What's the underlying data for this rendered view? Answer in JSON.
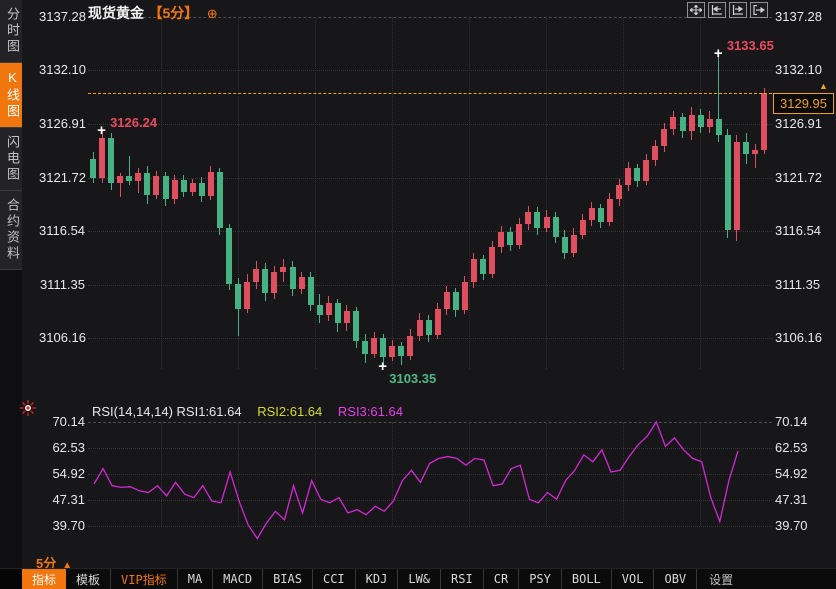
{
  "header": {
    "title": "现货黄金",
    "period_tag": "【5分】",
    "plus_icon": "⊕",
    "icons": [
      "pan-move-icon",
      "snap-left-icon",
      "snap-right-icon",
      "collapse-right-icon"
    ]
  },
  "sidebar": {
    "tabs": [
      {
        "label": "分时图",
        "active": false
      },
      {
        "label": "K线图",
        "active": true
      },
      {
        "label": "闪电图",
        "active": false
      },
      {
        "label": "合约资料",
        "active": false
      }
    ]
  },
  "colors": {
    "accent_orange": "#f2760e",
    "price_orange": "#f2a019",
    "up_red": "#e04f60",
    "down_green": "#46b182",
    "rsi_magenta": "#d428d4",
    "rsi_yellow": "#d8d832"
  },
  "chart_data": {
    "type": "candlestick",
    "symbol": "现货黄金",
    "interval": "5分",
    "y_axis_labels": [
      "3137.28",
      "3132.10",
      "3126.91",
      "3121.72",
      "3116.54",
      "3111.35",
      "3106.16"
    ],
    "y_axis_values": [
      3137.28,
      3132.1,
      3126.91,
      3121.72,
      3116.54,
      3111.35,
      3106.16
    ],
    "current_price": "3129.95",
    "current_price_value": 3129.95,
    "markers": [
      {
        "label": "3126.24",
        "price": 3126.24,
        "candle_index": 1,
        "type": "high",
        "color": "#ea4a5e"
      },
      {
        "label": "3133.65",
        "price": 3133.65,
        "candle_index": 69,
        "type": "high",
        "color": "#ea4a5e"
      },
      {
        "label": "3103.35",
        "price": 3103.35,
        "candle_index": 32,
        "type": "low",
        "color": "#4db887"
      }
    ],
    "candles": [
      [
        3123.5,
        3124.2,
        3121.2,
        3121.7
      ],
      [
        3121.7,
        3126.24,
        3121.2,
        3125.6
      ],
      [
        3125.6,
        3126.0,
        3120.5,
        3121.2
      ],
      [
        3121.2,
        3122.2,
        3119.8,
        3121.9
      ],
      [
        3121.9,
        3123.8,
        3121.0,
        3121.4
      ],
      [
        3121.4,
        3122.6,
        3120.2,
        3122.2
      ],
      [
        3122.2,
        3122.8,
        3119.2,
        3120.0
      ],
      [
        3120.0,
        3122.4,
        3119.6,
        3121.9
      ],
      [
        3121.9,
        3122.3,
        3119.0,
        3119.6
      ],
      [
        3119.6,
        3122.0,
        3119.2,
        3121.5
      ],
      [
        3121.5,
        3122.0,
        3119.8,
        3120.3
      ],
      [
        3120.3,
        3121.6,
        3119.9,
        3121.2
      ],
      [
        3121.2,
        3121.8,
        3119.4,
        3119.9
      ],
      [
        3119.9,
        3122.8,
        3119.5,
        3122.3
      ],
      [
        3122.3,
        3122.6,
        3116.2,
        3116.8
      ],
      [
        3116.8,
        3117.2,
        3110.8,
        3111.4
      ],
      [
        3111.4,
        3112.0,
        3106.4,
        3109.0
      ],
      [
        3109.0,
        3112.4,
        3108.6,
        3111.6
      ],
      [
        3111.6,
        3113.6,
        3110.9,
        3112.9
      ],
      [
        3112.9,
        3113.4,
        3109.8,
        3110.5
      ],
      [
        3110.5,
        3113.2,
        3110.0,
        3112.6
      ],
      [
        3112.6,
        3113.8,
        3111.6,
        3113.1
      ],
      [
        3113.1,
        3113.6,
        3110.2,
        3110.9
      ],
      [
        3110.9,
        3112.6,
        3110.4,
        3112.1
      ],
      [
        3112.1,
        3112.6,
        3108.8,
        3109.4
      ],
      [
        3109.4,
        3110.4,
        3107.6,
        3108.4
      ],
      [
        3108.4,
        3110.2,
        3107.8,
        3109.6
      ],
      [
        3109.6,
        3110.0,
        3106.8,
        3107.6
      ],
      [
        3107.6,
        3109.4,
        3106.9,
        3108.8
      ],
      [
        3108.8,
        3109.2,
        3105.2,
        3105.9
      ],
      [
        3105.9,
        3106.6,
        3103.8,
        3104.6
      ],
      [
        3104.6,
        3106.8,
        3104.2,
        3106.2
      ],
      [
        3106.2,
        3106.6,
        3103.35,
        3104.3
      ],
      [
        3104.3,
        3106.0,
        3103.9,
        3105.4
      ],
      [
        3105.4,
        3105.8,
        3103.6,
        3104.4
      ],
      [
        3104.4,
        3107.0,
        3104.0,
        3106.4
      ],
      [
        3106.4,
        3108.6,
        3105.9,
        3107.9
      ],
      [
        3107.9,
        3108.4,
        3105.8,
        3106.5
      ],
      [
        3106.5,
        3109.6,
        3106.1,
        3109.0
      ],
      [
        3109.0,
        3111.2,
        3108.4,
        3110.6
      ],
      [
        3110.6,
        3111.0,
        3108.2,
        3108.9
      ],
      [
        3108.9,
        3112.2,
        3108.5,
        3111.6
      ],
      [
        3111.6,
        3114.4,
        3111.0,
        3113.8
      ],
      [
        3113.8,
        3114.2,
        3111.8,
        3112.4
      ],
      [
        3112.4,
        3115.6,
        3112.0,
        3115.0
      ],
      [
        3115.0,
        3117.0,
        3114.4,
        3116.4
      ],
      [
        3116.4,
        3116.9,
        3114.6,
        3115.2
      ],
      [
        3115.2,
        3117.8,
        3114.8,
        3117.2
      ],
      [
        3117.2,
        3119.0,
        3116.6,
        3118.4
      ],
      [
        3118.4,
        3118.9,
        3116.2,
        3116.8
      ],
      [
        3116.8,
        3118.6,
        3116.4,
        3117.9
      ],
      [
        3117.9,
        3118.4,
        3115.4,
        3116.0
      ],
      [
        3116.0,
        3116.6,
        3113.8,
        3114.4
      ],
      [
        3114.4,
        3116.8,
        3114.0,
        3116.2
      ],
      [
        3116.2,
        3118.2,
        3115.8,
        3117.6
      ],
      [
        3117.6,
        3119.4,
        3117.0,
        3118.8
      ],
      [
        3118.8,
        3119.2,
        3116.8,
        3117.4
      ],
      [
        3117.4,
        3120.2,
        3117.0,
        3119.6
      ],
      [
        3119.6,
        3121.6,
        3119.0,
        3121.0
      ],
      [
        3121.0,
        3123.2,
        3120.4,
        3122.6
      ],
      [
        3122.6,
        3123.0,
        3120.8,
        3121.4
      ],
      [
        3121.4,
        3124.0,
        3121.0,
        3123.4
      ],
      [
        3123.4,
        3125.4,
        3122.8,
        3124.8
      ],
      [
        3124.8,
        3127.0,
        3124.2,
        3126.4
      ],
      [
        3126.4,
        3128.2,
        3125.8,
        3127.6
      ],
      [
        3127.6,
        3128.0,
        3125.6,
        3126.2
      ],
      [
        3126.2,
        3128.6,
        3125.4,
        3127.8
      ],
      [
        3127.8,
        3128.4,
        3126.0,
        3126.6
      ],
      [
        3126.6,
        3128.2,
        3126.0,
        3127.4
      ],
      [
        3127.4,
        3133.65,
        3125.2,
        3125.8
      ],
      [
        3125.8,
        3126.4,
        3115.9,
        3116.6
      ],
      [
        3116.6,
        3125.8,
        3115.6,
        3125.2
      ],
      [
        3125.2,
        3126.0,
        3123.0,
        3124.0
      ],
      [
        3124.0,
        3125.0,
        3122.6,
        3124.4
      ],
      [
        3124.4,
        3130.4,
        3124.0,
        3129.95
      ]
    ],
    "rsi": {
      "label_main": "RSI(14,14,14) RSI1:61.64",
      "label_2": "RSI2:61.64",
      "label_3": "RSI3:61.64",
      "axis_labels": [
        "70.14",
        "62.53",
        "54.92",
        "47.31",
        "39.70"
      ],
      "axis_values": [
        70.14,
        62.53,
        54.92,
        47.31,
        39.7
      ],
      "values": [
        52.0,
        56.5,
        51.5,
        51.0,
        51.2,
        50.0,
        49.5,
        51.5,
        48.5,
        52.5,
        49.0,
        48.0,
        51.5,
        47.0,
        46.5,
        55.5,
        47.0,
        40.0,
        36.0,
        40.5,
        44.0,
        41.5,
        51.5,
        43.5,
        53.0,
        47.5,
        46.5,
        48.0,
        43.5,
        44.5,
        43.0,
        45.5,
        44.0,
        47.0,
        53.0,
        56.0,
        52.5,
        58.0,
        59.5,
        60.0,
        59.5,
        57.5,
        59.5,
        59.0,
        51.5,
        52.0,
        56.5,
        57.5,
        47.5,
        46.5,
        49.5,
        47.5,
        53.0,
        56.0,
        60.5,
        58.5,
        62.0,
        55.5,
        56.0,
        60.0,
        63.5,
        66.0,
        70.14,
        63.0,
        65.5,
        62.0,
        59.5,
        58.5,
        48.0,
        41.0,
        53.0,
        61.64
      ]
    }
  },
  "footer": {
    "period": "5分",
    "period_arrow": "▲",
    "price_alarm_arrow": "▲",
    "tabs": [
      {
        "label": "指标",
        "style": "active"
      },
      {
        "label": "模板",
        "style": ""
      },
      {
        "label": "VIP指标",
        "style": "vip"
      },
      {
        "label": "MA",
        "style": ""
      },
      {
        "label": "MACD",
        "style": ""
      },
      {
        "label": "BIAS",
        "style": ""
      },
      {
        "label": "CCI",
        "style": ""
      },
      {
        "label": "KDJ",
        "style": ""
      },
      {
        "label": "LW&",
        "style": ""
      },
      {
        "label": "RSI",
        "style": ""
      },
      {
        "label": "CR",
        "style": ""
      },
      {
        "label": "PSY",
        "style": ""
      },
      {
        "label": "BOLL",
        "style": ""
      },
      {
        "label": "VOL",
        "style": ""
      },
      {
        "label": "OBV",
        "style": ""
      },
      {
        "label": "设置",
        "style": "muted"
      }
    ]
  }
}
